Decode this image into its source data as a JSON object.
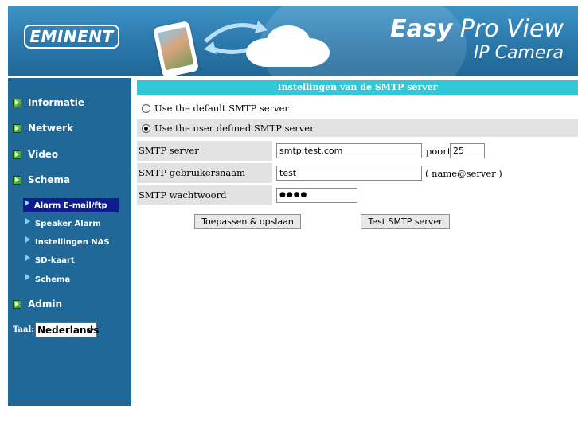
{
  "header": {
    "logo_text": "EMINENT",
    "brand_bold": "Easy",
    "brand_rest": " Pro View",
    "subtitle": "IP Camera"
  },
  "sidebar": {
    "items": [
      {
        "label": "Informatie"
      },
      {
        "label": "Netwerk"
      },
      {
        "label": "Video"
      },
      {
        "label": "Schema"
      }
    ],
    "sub_items": [
      {
        "label": "Alarm E-mail/ftp",
        "active": true
      },
      {
        "label": "Speaker Alarm"
      },
      {
        "label": "Instellingen NAS"
      },
      {
        "label": "SD-kaart"
      },
      {
        "label": "Schema"
      }
    ],
    "admin_label": "Admin",
    "language_label": "Taal:",
    "language_value": "Nederlands"
  },
  "smtp": {
    "title": "Instellingen van de SMTP server",
    "radio_default_label": "Use the default SMTP server",
    "radio_user_label": "Use the user defined SMTP server",
    "selected": "user",
    "server_label": "SMTP server",
    "server_value": "smtp.test.com",
    "port_label": "poort",
    "port_value": "25",
    "username_label": "SMTP gebruikersnaam",
    "username_value": "test",
    "username_hint": "( name@server )",
    "password_label": "SMTP wachtwoord",
    "password_value": "●●●●",
    "apply_button": "Toepassen & opslaan",
    "test_button": "Test SMTP server"
  },
  "colors": {
    "header_blue": "#2a77aa",
    "sidebar_blue": "#1f6897",
    "title_cyan": "#30c8d8",
    "active_navy": "#0e1d8e",
    "row_gray": "#e2e2e2"
  }
}
